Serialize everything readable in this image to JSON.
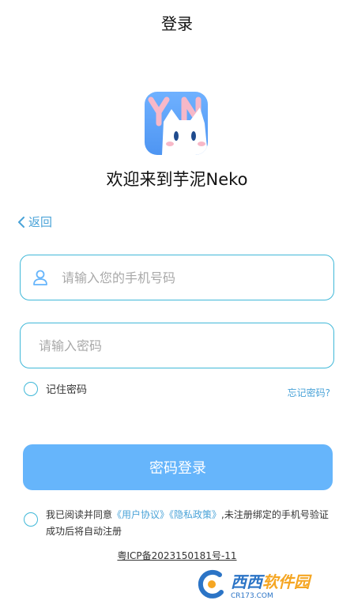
{
  "header": {
    "title": "登录"
  },
  "app": {
    "welcome": "欢迎来到芋泥Neko"
  },
  "nav": {
    "back_label": "返回"
  },
  "form": {
    "phone_placeholder": "请输入您的手机号码",
    "password_placeholder": "请输入密码",
    "remember_label": "记住密码",
    "forgot_label": "忘记密码?",
    "login_label": "密码登录"
  },
  "agreement": {
    "prefix": "我已阅读并同意",
    "user_agreement": "《用户协议》",
    "privacy_policy": "《隐私政策》",
    "suffix": ",未注册绑定的手机号验证成功后将自动注册"
  },
  "footer": {
    "icp": "粤ICP备2023150181号-11"
  },
  "watermark": {
    "brand": "西西",
    "name": "软件园",
    "site": "CR173.COM"
  },
  "colors": {
    "accent": "#40b8d8",
    "button": "#66b5fb",
    "link": "#4aa3d8"
  },
  "icons": {
    "back": "chevron-left-icon",
    "user": "user-icon"
  }
}
